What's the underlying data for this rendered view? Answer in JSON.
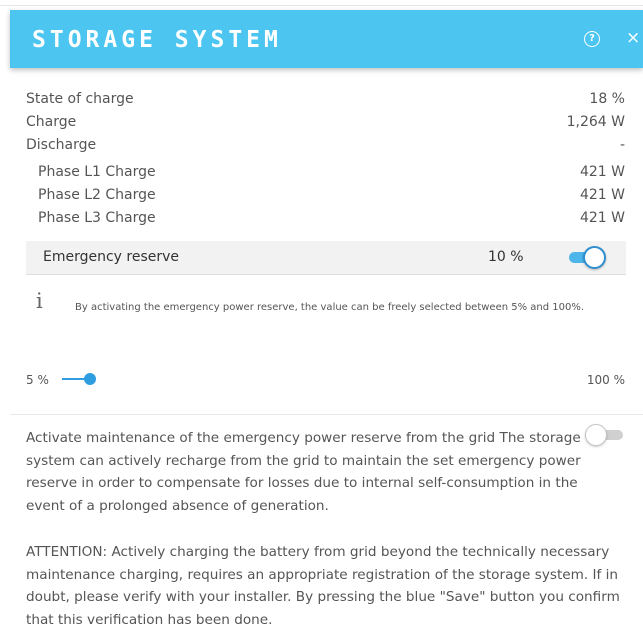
{
  "header": {
    "title": "STORAGE SYSTEM",
    "help_icon": "question-circle-icon",
    "close_icon": "close-icon",
    "help_glyph": "?",
    "close_glyph": "×",
    "background": "#4cc6f0"
  },
  "metrics": {
    "state_of_charge": {
      "label": "State of charge",
      "value": "18 %"
    },
    "charge": {
      "label": "Charge",
      "value": "1,264 W"
    },
    "discharge": {
      "label": "Discharge",
      "value": "-"
    },
    "phase_l1": {
      "label": "Phase L1 Charge",
      "value": "421 W"
    },
    "phase_l2": {
      "label": "Phase L2 Charge",
      "value": "421 W"
    },
    "phase_l3": {
      "label": "Phase L3 Charge",
      "value": "421 W"
    }
  },
  "emergency_reserve": {
    "label": "Emergency reserve",
    "value": "10 %",
    "toggle_on": true,
    "info_glyph": "i",
    "info_text": "By activating the emergency power reserve, the value can be freely selected between 5% and 100%.",
    "slider_min": "5 %",
    "slider_max": "100 %"
  },
  "maintenance": {
    "toggle_on": false,
    "paragraph1": "Activate maintenance of the emergency power reserve from the grid The storage system can actively recharge from the grid to maintain the set emergency power reserve in order to compensate for losses due to internal self-consumption in the event of a prolonged absence of generation.",
    "paragraph2": "ATTENTION: Actively charging the battery from grid beyond the technically necessary maintenance charging, requires an appropriate registration of the storage system. If in doubt, please verify with your installer. By pressing the blue \"Save\" button you confirm that this verification has been done."
  }
}
